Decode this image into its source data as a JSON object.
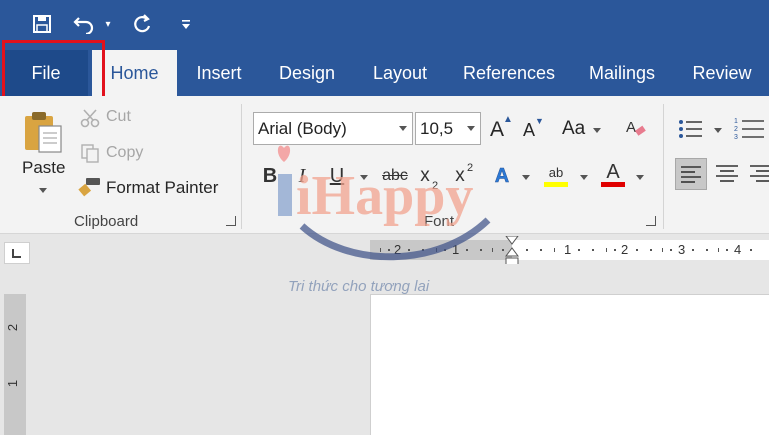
{
  "quick_access": {
    "save_icon": "save-icon",
    "undo_icon": "undo-icon",
    "redo_icon": "redo-icon",
    "customize_icon": "customize-qat-icon"
  },
  "tabs": [
    "File",
    "Home",
    "Insert",
    "Design",
    "Layout",
    "References",
    "Mailings",
    "Review"
  ],
  "active_tab": "Home",
  "clipboard": {
    "paste": "Paste",
    "cut": "Cut",
    "copy": "Copy",
    "format_painter": "Format Painter",
    "group_label": "Clipboard"
  },
  "font": {
    "font_name": "Arial (Body)",
    "font_size": "10,5",
    "grow": "A",
    "shrink": "A",
    "change_case": "Aa",
    "bold": "B",
    "italic": "I",
    "underline": "U",
    "strikethrough": "abc",
    "subscript": "x",
    "subscript_mark": "2",
    "superscript": "x",
    "superscript_mark": "2",
    "text_effects": "A",
    "highlight": "ab",
    "font_color": "A",
    "group_label": "Font"
  },
  "ruler": {
    "horizontal": [
      "2",
      "1",
      "1",
      "2",
      "3",
      "4"
    ],
    "vertical": [
      "2",
      "1"
    ]
  },
  "watermark": {
    "brand": "iHappy",
    "tagline": "Tri thức cho tương lai"
  },
  "colors": {
    "accent": "#2b579a",
    "highlight_outline": "#e2111c",
    "highlight_yellow": "#ffff00",
    "font_color_red": "#e00000"
  }
}
